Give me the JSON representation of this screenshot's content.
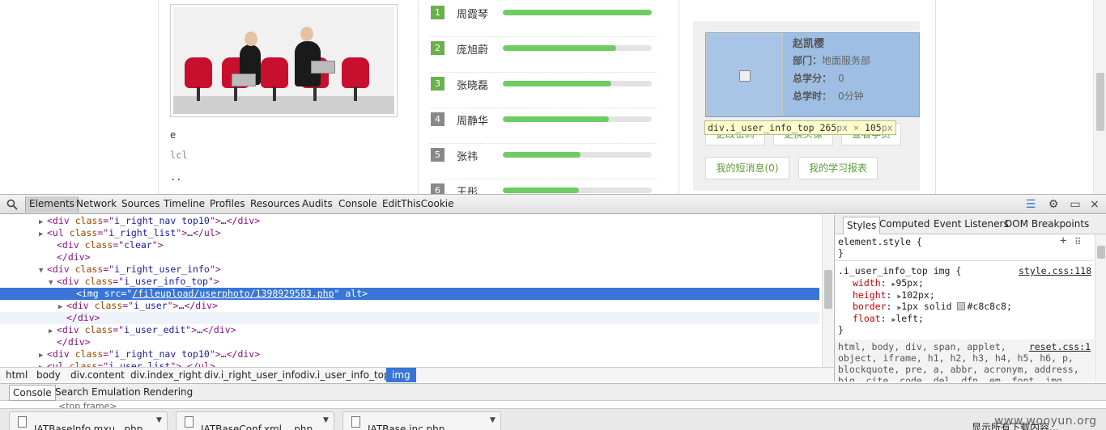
{
  "page": {
    "left_text": {
      "e": "e",
      "lcl": "lcl",
      "dots": ".."
    },
    "ranking": [
      {
        "num": "1",
        "name": "周霞琴",
        "progress": 1.0,
        "badge": "green"
      },
      {
        "num": "2",
        "name": "庞旭蔚",
        "progress": 0.76,
        "badge": "green"
      },
      {
        "num": "3",
        "name": "张晓磊",
        "progress": 0.73,
        "badge": "green"
      },
      {
        "num": "4",
        "name": "周静华",
        "progress": 0.71,
        "badge": "gray"
      },
      {
        "num": "5",
        "name": "张祎",
        "progress": 0.52,
        "badge": "gray"
      },
      {
        "num": "6",
        "name": "王彤",
        "progress": 0.51,
        "badge": "gray"
      }
    ],
    "user": {
      "name": "赵凯樱",
      "dept_label": "部门：",
      "dept_value": "地面服务部",
      "score_label": "总学分：",
      "score_value": "0",
      "time_label": "总学时：",
      "time_value": "0分钟"
    },
    "tooltip": {
      "selector": "div.i_user_info_top",
      "width": "265",
      "height": "105",
      "unit": "px",
      "times": "×"
    },
    "buttons": {
      "change_password": "更改密码",
      "change_avatar": "更换头像",
      "view_student": "查看学员",
      "messages": "我的短消息(0)",
      "report": "我的学习报表"
    }
  },
  "devtools": {
    "tabs": [
      "Elements",
      "Network",
      "Sources",
      "Timeline",
      "Profiles",
      "Resources",
      "Audits",
      "Console",
      "EditThisCookie"
    ],
    "active_tab": "Elements",
    "dom_lines": [
      {
        "indent": 4,
        "tri": "▶",
        "parts": [
          [
            "tg",
            "<div "
          ],
          [
            "at",
            "class"
          ],
          [
            "tg",
            "=\""
          ],
          [
            "av",
            "i_right_nav top10"
          ],
          [
            "tg",
            "\">"
          ],
          [
            "tx",
            "…"
          ],
          [
            "tg",
            "</div>"
          ]
        ]
      },
      {
        "indent": 4,
        "tri": "▶",
        "parts": [
          [
            "tg",
            "<ul "
          ],
          [
            "at",
            "class"
          ],
          [
            "tg",
            "=\""
          ],
          [
            "av",
            "i_right_list"
          ],
          [
            "tg",
            "\">"
          ],
          [
            "tx",
            "…"
          ],
          [
            "tg",
            "</ul>"
          ]
        ]
      },
      {
        "indent": 5,
        "tri": "",
        "parts": [
          [
            "tg",
            "<div "
          ],
          [
            "at",
            "class"
          ],
          [
            "tg",
            "=\""
          ],
          [
            "av",
            "clear"
          ],
          [
            "tg",
            "\">"
          ]
        ]
      },
      {
        "indent": 5,
        "tri": "",
        "parts": [
          [
            "tg",
            "</div>"
          ]
        ]
      },
      {
        "indent": 4,
        "tri": "▼",
        "parts": [
          [
            "tg",
            "<div "
          ],
          [
            "at",
            "class"
          ],
          [
            "tg",
            "=\""
          ],
          [
            "av",
            "i_right_user_info"
          ],
          [
            "tg",
            "\">"
          ]
        ]
      },
      {
        "indent": 5,
        "tri": "▼",
        "parts": [
          [
            "tg",
            "<div "
          ],
          [
            "at",
            "class"
          ],
          [
            "tg",
            "=\""
          ],
          [
            "av",
            "i_user_info_top"
          ],
          [
            "tg",
            "\">"
          ]
        ]
      },
      {
        "indent": 7,
        "tri": "",
        "selected": true,
        "parts": [
          [
            "tg",
            "<img "
          ],
          [
            "at",
            "src"
          ],
          [
            "tg",
            "=\""
          ],
          [
            "lnk",
            "/fileupload/userphoto/1398929583.php"
          ],
          [
            "tg",
            "\" "
          ],
          [
            "at",
            "alt"
          ],
          [
            "tg",
            ">"
          ]
        ]
      },
      {
        "indent": 6,
        "tri": "▶",
        "parts": [
          [
            "tg",
            "<div "
          ],
          [
            "at",
            "class"
          ],
          [
            "tg",
            "=\""
          ],
          [
            "av",
            "i_user"
          ],
          [
            "tg",
            "\">"
          ],
          [
            "tx",
            "…"
          ],
          [
            "tg",
            "</div>"
          ]
        ]
      },
      {
        "indent": 6,
        "tri": "",
        "hover": true,
        "parts": [
          [
            "tg",
            "</div>"
          ]
        ]
      },
      {
        "indent": 5,
        "tri": "▶",
        "parts": [
          [
            "tg",
            "<div "
          ],
          [
            "at",
            "class"
          ],
          [
            "tg",
            "=\""
          ],
          [
            "av",
            "i_user_edit"
          ],
          [
            "tg",
            "\">"
          ],
          [
            "tx",
            "…"
          ],
          [
            "tg",
            "</div>"
          ]
        ]
      },
      {
        "indent": 5,
        "tri": "",
        "parts": [
          [
            "tg",
            "</div>"
          ]
        ]
      },
      {
        "indent": 4,
        "tri": "▶",
        "parts": [
          [
            "tg",
            "<div "
          ],
          [
            "at",
            "class"
          ],
          [
            "tg",
            "=\""
          ],
          [
            "av",
            "i_right_nav top10"
          ],
          [
            "tg",
            "\">"
          ],
          [
            "tx",
            "…"
          ],
          [
            "tg",
            "</div>"
          ]
        ]
      },
      {
        "indent": 4,
        "tri": "▶",
        "parts": [
          [
            "tg",
            "<ul "
          ],
          [
            "at",
            "class"
          ],
          [
            "tg",
            "=\""
          ],
          [
            "av",
            "i_user_list"
          ],
          [
            "tg",
            "\">"
          ],
          [
            "tx",
            "…"
          ],
          [
            "tg",
            "</ul>"
          ]
        ]
      }
    ],
    "breadcrumbs": [
      "html",
      "body",
      "div.content",
      "div.index_right",
      "div.i_right_user_info",
      "div.i_user_info_top",
      "img"
    ],
    "side_tabs": [
      "Styles",
      "Computed",
      "Event Listeners",
      "DOM Breakpoints"
    ],
    "styles": {
      "element_style": "element.style {",
      "close": "}",
      "rule_selector": ".i_user_info_top img {",
      "rule_source": "style.css:118",
      "decls": [
        {
          "prop": "width",
          "value": "95px;"
        },
        {
          "prop": "height",
          "value": "102px;"
        },
        {
          "prop": "border",
          "value": "1px solid",
          "swatch": "#c8c8c8",
          "tail": "#c8c8c8;"
        },
        {
          "prop": "float",
          "value": "left;"
        }
      ],
      "reset_lines": [
        "html, body, div, span, applet,",
        "object, iframe, h1, h2, h3, h4, h5, h6, p,",
        "blockquote, pre, a, abbr, acronym, address,",
        "big, cite, code, del, dfn, em, font, img,"
      ],
      "reset_source": "reset.css:1"
    },
    "drawer_tabs": [
      "Console",
      "Search",
      "Emulation",
      "Rendering"
    ],
    "console_line": "<top frame>"
  },
  "downloads": {
    "items": [
      "IATBaseInfo.mxu...php",
      "IATBaseConf.xml....php",
      "IATBase.inc.php"
    ],
    "right_text": "显示所有下载内容...",
    "watermark": "www.wooyun.org"
  }
}
